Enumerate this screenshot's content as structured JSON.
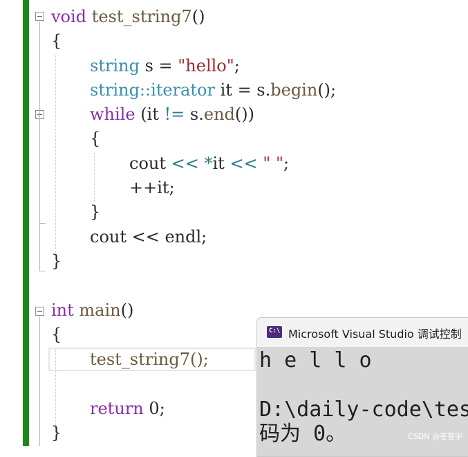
{
  "code": {
    "l1": {
      "kw": "void",
      "name": "test_string7",
      "punc": "()"
    },
    "l2": {
      "brace": "{"
    },
    "l3": {
      "type": "string",
      "mid": " s = ",
      "str": "\"hello\"",
      "end": ";"
    },
    "l4": {
      "type": "string::iterator",
      "mid": " it = s.",
      "fn": "begin",
      "end": "();"
    },
    "l5": {
      "kw": "while",
      "mid": " (it ",
      "op": "!=",
      "mid2": " s.",
      "fn": "end",
      "end": "())"
    },
    "l6": {
      "brace": "{"
    },
    "l7": {
      "fn": "cout",
      "op1": " << ",
      "op2": "*",
      "ident": "it",
      "op3": " << ",
      "str": "\" \"",
      "end": ";"
    },
    "l8": {
      "text": "++it;"
    },
    "l9": {
      "brace": "}"
    },
    "l10": {
      "text": "cout << endl;"
    },
    "l11": {
      "brace": "}"
    },
    "l12": {
      "kw": "int",
      "name": "main",
      "punc": "()"
    },
    "l13": {
      "brace": "{"
    },
    "l14": {
      "text": "test_string7();"
    },
    "l15": {
      "kw": "return",
      "num": " 0;"
    },
    "l16": {
      "brace": "}"
    }
  },
  "console": {
    "title": "Microsoft Visual Studio 调试控制",
    "output_line1": "h e l l o",
    "output_line2": "D:\\daily-code\\tes",
    "output_line3": "码为 0。",
    "watermark": "CSDN @苍苍宇"
  }
}
